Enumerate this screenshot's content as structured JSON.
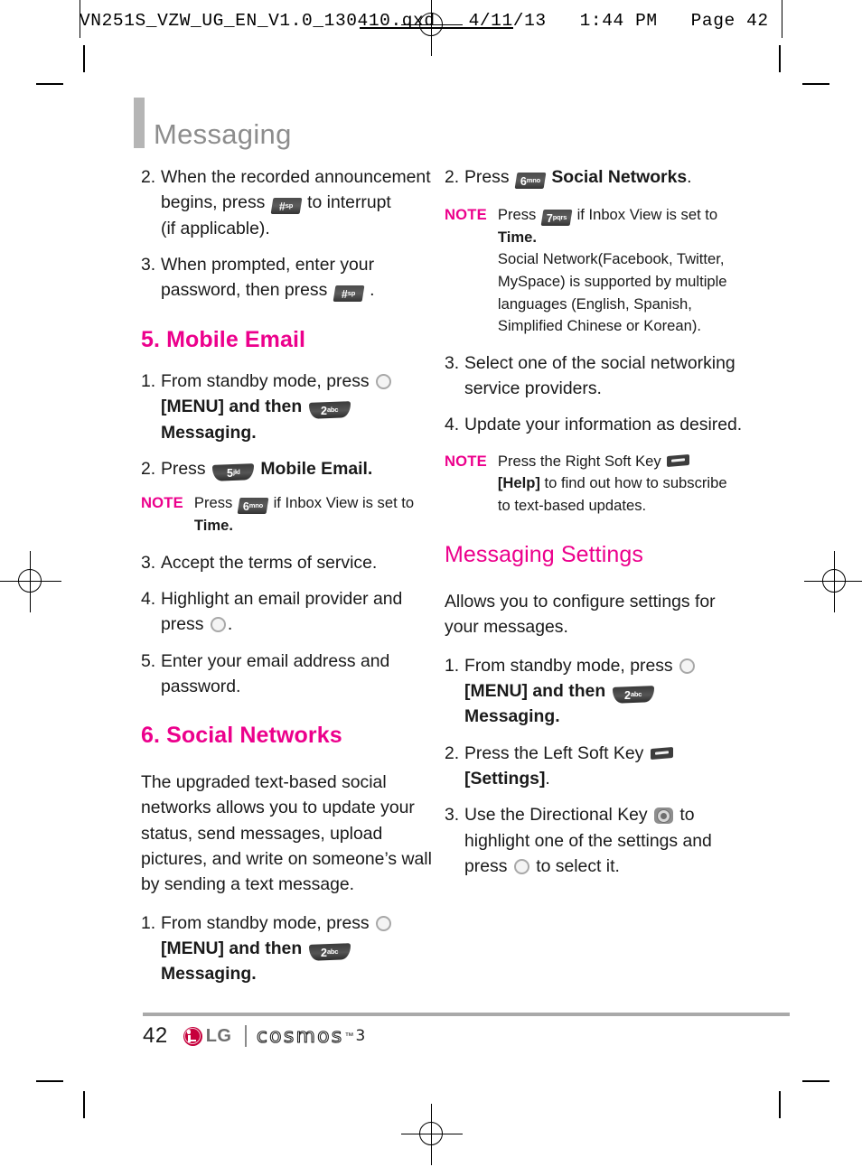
{
  "print_header": {
    "text": "VN251S_VZW_UG_EN_V1.0_130410.qxd   4/11/13   1:44 PM   Page 42"
  },
  "chapter": {
    "title": "Messaging"
  },
  "colors": {
    "accent_magenta": "#ec008c",
    "chapter_gray": "#8d8d8d",
    "rule_gray": "#a9a9a9",
    "lg_red": "#c6003c"
  },
  "left_column": {
    "step2": {
      "num": "2.",
      "part1": "When the recorded announcement begins, press",
      "key": {
        "label": "#",
        "sup": "space"
      },
      "part2": "to interrupt",
      "part3": "(if applicable)."
    },
    "step3": {
      "num": "3.",
      "part1": "When prompted, enter your password, then press",
      "key": {
        "label": "#",
        "sup": "space"
      },
      "part2": "."
    },
    "heading_mobile_email": "5. Mobile Email",
    "me_step1": {
      "num": "1.",
      "part1": "From standby mode, press",
      "ok_key": "OK",
      "part2": "[MENU] and then",
      "key": {
        "label": "2",
        "sup": "abc"
      },
      "part3": "Messaging."
    },
    "me_step2": {
      "num": "2.",
      "part1": "Press",
      "key": {
        "label": "5",
        "sup": "jkl"
      },
      "part2": "Mobile Email."
    },
    "me_note": {
      "label": "NOTE",
      "part1": "Press",
      "key": {
        "label": "6",
        "sup": "mno"
      },
      "part2": "if Inbox View is set to",
      "bold_word": "Time",
      "part3": "."
    },
    "me_step3": {
      "num": "3.",
      "text": "Accept the terms of service."
    },
    "me_step4": {
      "num": "4.",
      "part1": "Highlight an email provider and press",
      "ok_key": "OK",
      "part2": "."
    },
    "me_step5": {
      "num": "5.",
      "text": "Enter your email address and password."
    },
    "heading_social_networks": "6. Social Networks",
    "sn_intro": "The upgraded text-based social networks allows you to update your status, send messages, upload pictures, and write on someone’s wall by sending a text message.",
    "sn_step1": {
      "num": "1.",
      "part1": "From standby mode, press",
      "ok_key": "OK",
      "part2": "[MENU] and then",
      "key": {
        "label": "2",
        "sup": "abc"
      },
      "part3": "Messaging."
    }
  },
  "right_column": {
    "sn_step2": {
      "num": "2.",
      "part1": "Press",
      "key": {
        "label": "6",
        "sup": "mno"
      },
      "part2": "Social Networks",
      "part3": "."
    },
    "sn_note": {
      "label": "NOTE",
      "part1": "Press",
      "key": {
        "label": "7",
        "sup": "pqrs"
      },
      "part2": "if Inbox View is set to",
      "bold_word": "Time",
      "part3": ".",
      "part4": "Social Network(Facebook, Twitter, MySpace) is supported by multiple languages (English, Spanish, Simplified Chinese or Korean)."
    },
    "sn_step3": {
      "num": "3.",
      "text": "Select one of the social networking service providers."
    },
    "sn_step4": {
      "num": "4.",
      "text": "Update your information as desired."
    },
    "help_note": {
      "label": "NOTE",
      "part1": "Press the Right Soft Key",
      "softkey": "right-soft-key",
      "part2": "[Help]",
      "part3": " to find out how to subscribe to text-based updates."
    },
    "heading_messaging_settings": "Messaging Settings",
    "ms_intro": "Allows you to configure settings for your messages.",
    "ms_step1": {
      "num": "1.",
      "part1": "From standby mode, press",
      "ok_key": "OK",
      "part2": "[MENU] and then",
      "key": {
        "label": "2",
        "sup": "abc"
      },
      "part3": "Messaging."
    },
    "ms_step2": {
      "num": "2.",
      "part1": "Press the Left Soft Key",
      "softkey": "left-soft-key",
      "part2": "[Settings]",
      "part3": "."
    },
    "ms_step3": {
      "num": "3.",
      "part1": "Use the Directional Key",
      "dirkey": "directional-key",
      "part2": "to highlight one of the settings and press",
      "ok_key": "OK",
      "part3": "to select it."
    }
  },
  "footer": {
    "page_number": "42",
    "brand": "LG",
    "product": "cosmos",
    "trademark": "™",
    "model": "3"
  }
}
